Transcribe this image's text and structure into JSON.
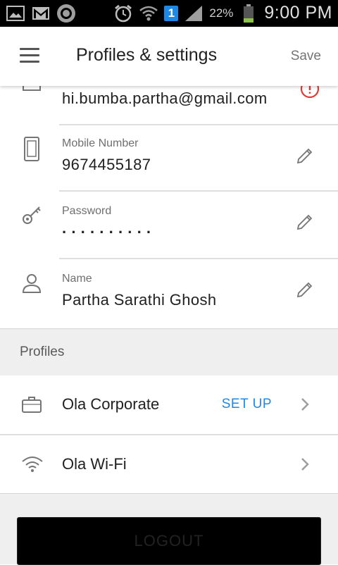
{
  "status_bar": {
    "notification_badge": "1",
    "battery_percent": "22%",
    "time": "9:00 PM"
  },
  "app_bar": {
    "title": "Profiles & settings",
    "save_label": "Save"
  },
  "account": {
    "email": {
      "value": "hi.bumba.partha@gmail.com",
      "warning_icon": "alert-circle-icon"
    },
    "mobile": {
      "label": "Mobile Number",
      "value": "9674455187"
    },
    "password": {
      "label": "Password",
      "value": "··········"
    },
    "name": {
      "label": "Name",
      "value": "Partha Sarathi Ghosh"
    }
  },
  "profiles": {
    "header": "Profiles",
    "items": [
      {
        "label": "Ola Corporate",
        "action": "SET UP",
        "icon": "briefcase-icon"
      },
      {
        "label": "Ola Wi-Fi",
        "icon": "wifi-icon"
      }
    ]
  },
  "logout_label": "LOGOUT",
  "colors": {
    "accent": "#1e88e5",
    "warning": "#e53935"
  }
}
